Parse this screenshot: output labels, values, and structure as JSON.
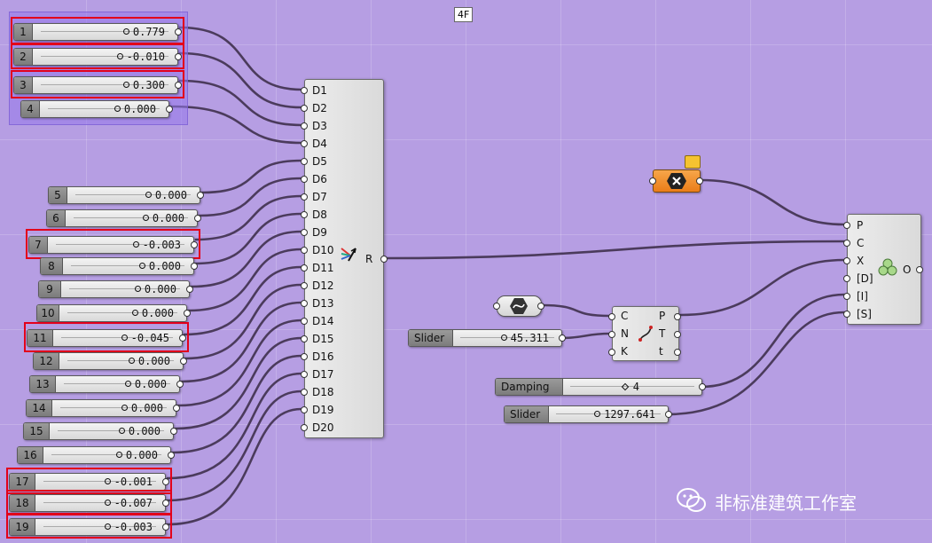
{
  "top_marker": "4F",
  "sliders": [
    {
      "label": "1",
      "value": "0.779"
    },
    {
      "label": "2",
      "value": "-0.010"
    },
    {
      "label": "3",
      "value": "0.300"
    },
    {
      "label": "4",
      "value": "0.000"
    },
    {
      "label": "5",
      "value": "0.000"
    },
    {
      "label": "6",
      "value": "0.000"
    },
    {
      "label": "7",
      "value": "-0.003"
    },
    {
      "label": "8",
      "value": "0.000"
    },
    {
      "label": "9",
      "value": "0.000"
    },
    {
      "label": "10",
      "value": "0.000"
    },
    {
      "label": "11",
      "value": "-0.045"
    },
    {
      "label": "12",
      "value": "0.000"
    },
    {
      "label": "13",
      "value": "0.000"
    },
    {
      "label": "14",
      "value": "0.000"
    },
    {
      "label": "15",
      "value": "0.000"
    },
    {
      "label": "16",
      "value": "0.000"
    },
    {
      "label": "17",
      "value": "-0.001"
    },
    {
      "label": "18",
      "value": "-0.007"
    },
    {
      "label": "19",
      "value": "-0.003"
    }
  ],
  "extra_sliders": [
    {
      "label": "Slider",
      "value": "45.311"
    },
    {
      "label": "Damping",
      "value": "4"
    },
    {
      "label": "Slider",
      "value": "1297.641"
    }
  ],
  "merge": {
    "inputs": [
      "D1",
      "D2",
      "D3",
      "D4",
      "D5",
      "D6",
      "D7",
      "D8",
      "D9",
      "D10",
      "D11",
      "D12",
      "D13",
      "D14",
      "D15",
      "D16",
      "D17",
      "D18",
      "D19",
      "D20"
    ],
    "output": "R"
  },
  "spring": {
    "inputs": [
      "C",
      "N",
      "K"
    ],
    "outputs": [
      "P",
      "T",
      "t"
    ]
  },
  "solver": {
    "inputs": [
      "P",
      "C",
      "X",
      "[D]",
      "[I]",
      "[S]"
    ],
    "output": "O"
  },
  "watermark": "非标准建筑工作室",
  "colors": {
    "canvas": "#b69ee3",
    "highlight": "#e3001b",
    "toggle": "#f08a24"
  }
}
